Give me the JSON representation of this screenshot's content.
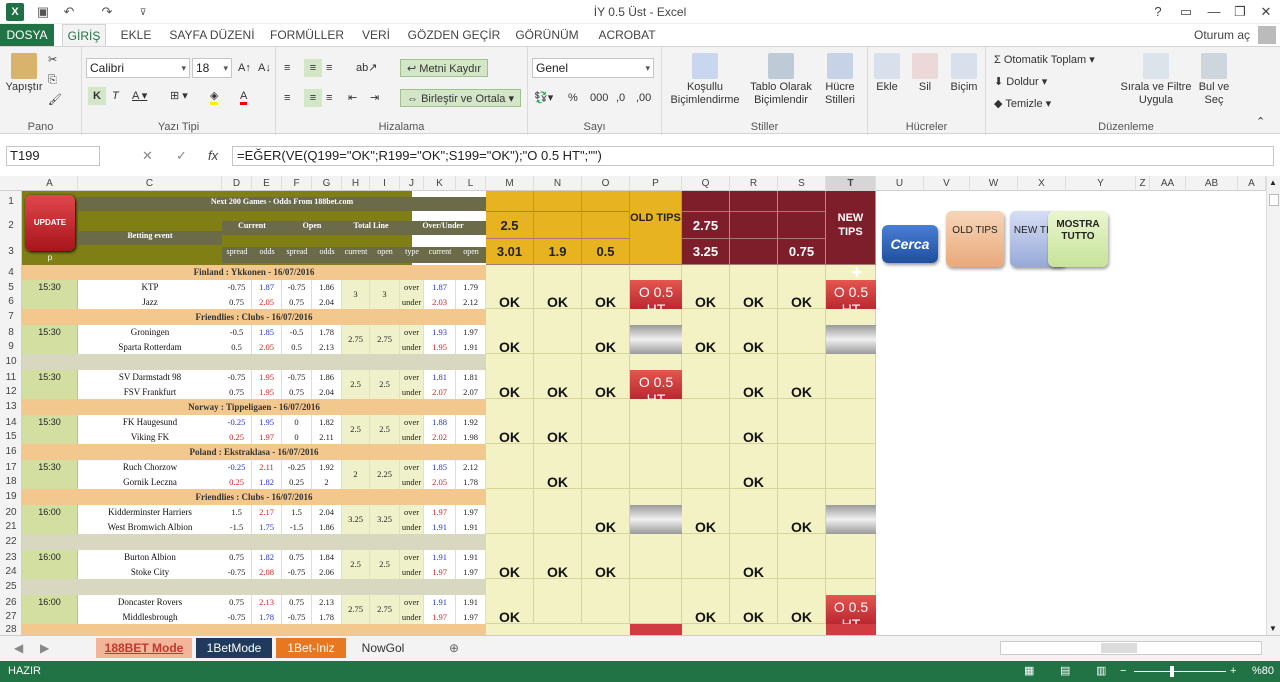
{
  "title": "İY 0.5 Üst - Excel",
  "signin": "Oturum aç",
  "tabs": [
    "DOSYA",
    "GİRİŞ",
    "EKLE",
    "SAYFA DÜZENİ",
    "FORMÜLLER",
    "VERİ",
    "GÖZDEN GEÇİR",
    "GÖRÜNÜM",
    "ACROBAT"
  ],
  "ribbon": {
    "paste": "Yapıştır",
    "clipboard": "Pano",
    "font_name": "Calibri",
    "font_size": "18",
    "font_group": "Yazı Tipi",
    "wrap": "Metni Kaydır",
    "merge": "Birleştir ve Ortala",
    "align_group": "Hizalama",
    "number_format": "Genel",
    "number_group": "Sayı",
    "cond_fmt": "Koşullu Biçimlendirme",
    "table_fmt": "Tablo Olarak Biçimlendir",
    "cell_styles": "Hücre Stilleri",
    "styles_group": "Stiller",
    "insert": "Ekle",
    "delete": "Sil",
    "format": "Biçim",
    "cells_group": "Hücreler",
    "autosum": "Otomatik Toplam",
    "fill": "Doldur",
    "clear": "Temizle",
    "sort": "Sırala ve Filtre Uygula",
    "find": "Bul ve Seç",
    "edit_group": "Düzenleme"
  },
  "namebox": "T199",
  "formula": "=EĞER(VE(Q199=\"OK\";R199=\"OK\";S199=\"OK\");\"O 0.5 HT\";\"\")",
  "columns": [
    "A",
    "C",
    "D",
    "E",
    "F",
    "G",
    "H",
    "I",
    "J",
    "K",
    "L",
    "M",
    "N",
    "O",
    "P",
    "Q",
    "R",
    "S",
    "T",
    "U",
    "V",
    "W",
    "X",
    "Y",
    "Z",
    "AA",
    "AB",
    "A"
  ],
  "rows": [
    "1",
    "2",
    "3",
    "4",
    "5",
    "6",
    "7",
    "8",
    "9",
    "10",
    "11",
    "12",
    "13",
    "14",
    "15",
    "16",
    "17",
    "18",
    "19",
    "20",
    "21",
    "22",
    "23",
    "24",
    "25",
    "26",
    "27",
    "28"
  ],
  "header": {
    "title": "Next 200 Games - Odds From 188bet.com",
    "betting": "Betting event",
    "current": "Current",
    "open": "Open",
    "total": "Total Line",
    "ou": "Over/Under",
    "sub": [
      "spread",
      "odds",
      "spread",
      "odds",
      "current",
      "open",
      "type",
      "current",
      "open"
    ],
    "update": "UPDATE",
    "p": "p"
  },
  "top": {
    "m2": "2.5",
    "m3": "3.01",
    "n3": "1.9",
    "o3": "0.5",
    "old": "OLD TIPS",
    "q2": "2.75",
    "q3": "3.25",
    "s3": "0.75",
    "new": "NEW TIPS"
  },
  "buttons": {
    "cerca": "Cerca",
    "old": "OLD TIPS",
    "new": "NEW TIPS",
    "mostra": "MOSTRA TUTTO"
  },
  "matches": [
    {
      "league": "Finland : Ykkonen - 16/07/2016",
      "time": "15:30",
      "home": "KTP",
      "away": "Jazz",
      "h": [
        "-0.75",
        "1.87",
        "-0.75",
        "1.86",
        "3",
        "3",
        "over",
        "1.87",
        "1.79"
      ],
      "a": [
        "0.75",
        "2.05",
        "0.75",
        "2.04",
        "",
        "",
        "under",
        "2.03",
        "2.12"
      ],
      "m": "OK",
      "n": "OK",
      "o": "OK",
      "p": "tip",
      "q": "OK",
      "r": "OK",
      "s": "OK",
      "t": "tip"
    },
    {
      "league": "Friendlies : Clubs - 16/07/2016",
      "time": "15:30",
      "home": "Groningen",
      "away": "Sparta Rotterdam",
      "h": [
        "-0.5",
        "1.85",
        "-0.5",
        "1.78",
        "2.75",
        "2.75",
        "over",
        "1.93",
        "1.97"
      ],
      "a": [
        "0.5",
        "2.05",
        "0.5",
        "2.13",
        "",
        "",
        "under",
        "1.95",
        "1.91"
      ],
      "m": "OK",
      "n": "",
      "o": "OK",
      "p": "silver",
      "q": "OK",
      "r": "OK",
      "s": "",
      "t": "silver"
    },
    {
      "league": "",
      "time": "15:30",
      "home": "SV Darmstadt 98",
      "away": "FSV Frankfurt",
      "h": [
        "-0.75",
        "1.95",
        "-0.75",
        "1.86",
        "2.5",
        "2.5",
        "over",
        "1.81",
        "1.81"
      ],
      "a": [
        "0.75",
        "1.95",
        "0.75",
        "2.04",
        "",
        "",
        "under",
        "2.07",
        "2.07"
      ],
      "m": "OK",
      "n": "OK",
      "o": "OK",
      "p": "tip",
      "q": "",
      "r": "OK",
      "s": "OK",
      "t": ""
    },
    {
      "league": "Norway : Tippeligaen - 16/07/2016",
      "time": "15:30",
      "home": "FK Haugesund",
      "away": "Viking FK",
      "h": [
        "-0.25",
        "1.95",
        "0",
        "1.82",
        "2.5",
        "2.5",
        "over",
        "1.88",
        "1.92"
      ],
      "a": [
        "0.25",
        "1.97",
        "0",
        "2.11",
        "",
        "",
        "under",
        "2.02",
        "1.98"
      ],
      "m": "OK",
      "n": "OK",
      "o": "",
      "p": "",
      "q": "",
      "r": "OK",
      "s": "",
      "t": ""
    },
    {
      "league": "Poland : Ekstraklasa - 16/07/2016",
      "time": "15:30",
      "home": "Ruch Chorzow",
      "away": "Gornik Leczna",
      "h": [
        "-0.25",
        "2.11",
        "-0.25",
        "1.92",
        "2",
        "2.25",
        "over",
        "1.85",
        "2.12"
      ],
      "a": [
        "0.25",
        "1.82",
        "0.25",
        "2",
        "",
        "",
        "under",
        "2.05",
        "1.78"
      ],
      "m": "",
      "n": "OK",
      "o": "",
      "p": "",
      "q": "",
      "r": "OK",
      "s": "",
      "t": ""
    },
    {
      "league": "Friendlies : Clubs - 16/07/2016",
      "time": "16:00",
      "home": "Kidderminster Harriers",
      "away": "West Bromwich Albion",
      "h": [
        "1.5",
        "2.17",
        "1.5",
        "2.04",
        "3.25",
        "3.25",
        "over",
        "1.97",
        "1.97"
      ],
      "a": [
        "-1.5",
        "1.75",
        "-1.5",
        "1.86",
        "",
        "",
        "under",
        "1.91",
        "1.91"
      ],
      "m": "",
      "n": "",
      "o": "OK",
      "p": "silver",
      "q": "OK",
      "r": "",
      "s": "OK",
      "t": "silver"
    },
    {
      "league": "",
      "time": "16:00",
      "home": "Burton Albion",
      "away": "Stoke City",
      "h": [
        "0.75",
        "1.82",
        "0.75",
        "1.84",
        "2.5",
        "2.5",
        "over",
        "1.91",
        "1.91"
      ],
      "a": [
        "-0.75",
        "2.08",
        "-0.75",
        "2.06",
        "",
        "",
        "under",
        "1.97",
        "1.97"
      ],
      "m": "OK",
      "n": "OK",
      "o": "OK",
      "p": "",
      "q": "",
      "r": "OK",
      "s": "",
      "t": ""
    },
    {
      "league": "",
      "time": "16:00",
      "home": "Doncaster Rovers",
      "away": "Middlesbrough",
      "h": [
        "0.75",
        "2.13",
        "0.75",
        "2.13",
        "2.75",
        "2.75",
        "over",
        "1.91",
        "1.91"
      ],
      "a": [
        "-0.75",
        "1.78",
        "-0.75",
        "1.78",
        "",
        "",
        "under",
        "1.97",
        "1.97"
      ],
      "m": "OK",
      "n": "",
      "o": "",
      "p": "",
      "q": "OK",
      "r": "OK",
      "s": "OK",
      "t": "tip"
    }
  ],
  "tip_text": "O 0.5 HT",
  "sheets": [
    "188BET Mode",
    "1BetMode",
    "1Bet-Iniz",
    "NowGol"
  ],
  "status": {
    "ready": "HAZIR",
    "zoom": "%80"
  }
}
